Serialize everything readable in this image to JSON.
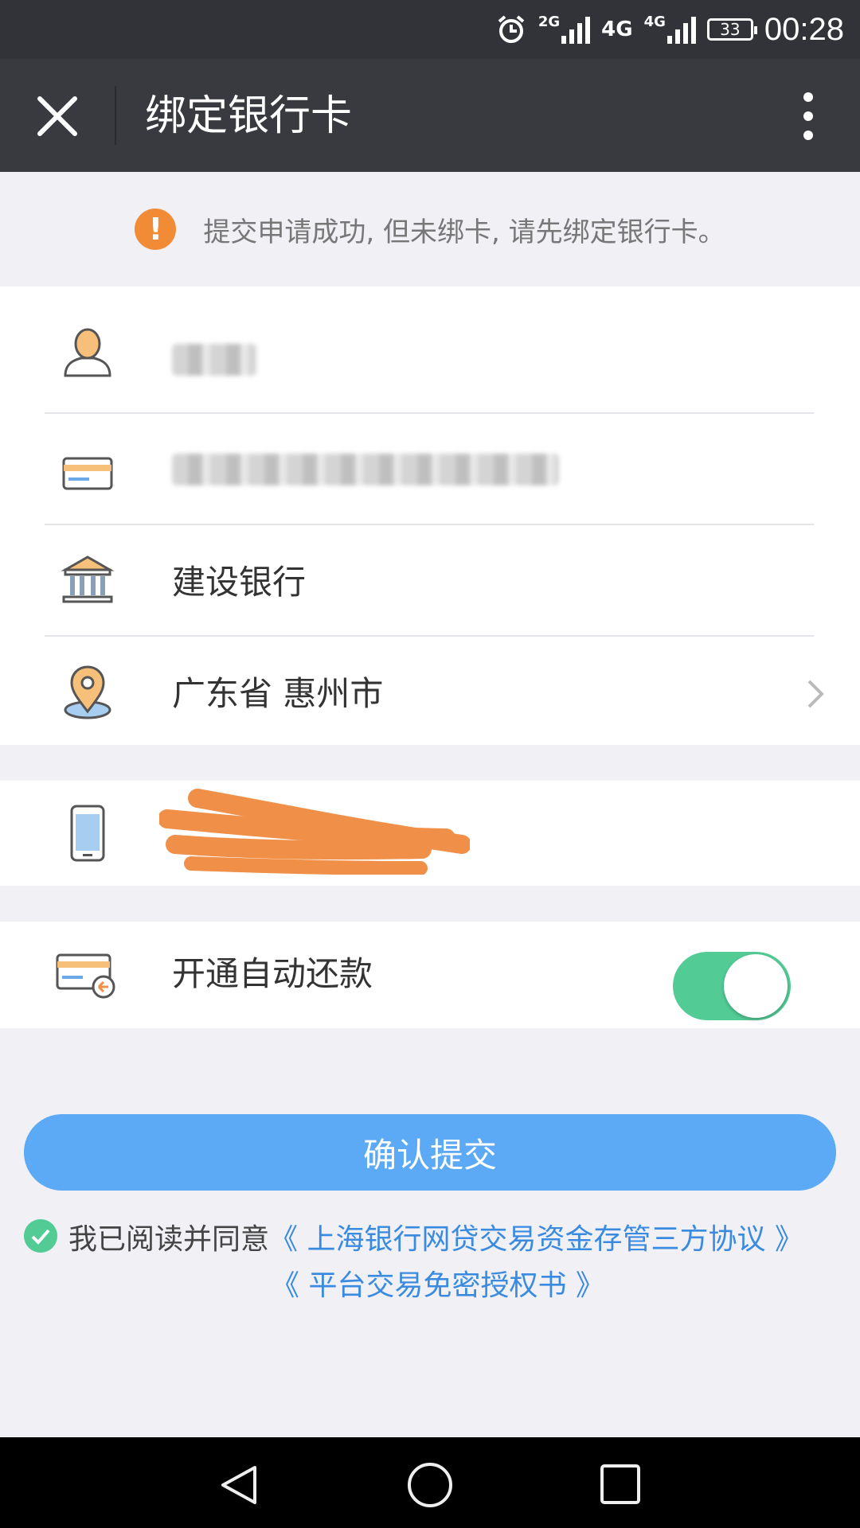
{
  "status_bar": {
    "network_2g": "2G",
    "network_4g_a": "4G",
    "network_4g_b": "4G",
    "battery": "33",
    "time": "00:28"
  },
  "nav": {
    "title": "绑定银行卡",
    "close_icon": "close-icon",
    "more_icon": "more-vertical-icon"
  },
  "notice": {
    "text": "提交申请成功, 但未绑卡, 请先绑定银行卡。",
    "icon": "warning-icon",
    "icon_glyph": "!",
    "icon_color": "#f28b35"
  },
  "form": {
    "bank_name": "建设银行",
    "region": "广东省 惠州市"
  },
  "auto_repay": {
    "label": "开通自动还款",
    "enabled": true,
    "toggle_color": "#52cb95"
  },
  "confirm_button": {
    "label": "确认提交",
    "color": "#5ca9f6"
  },
  "agreement": {
    "checked": true,
    "prefix": "我已阅读并同意",
    "link1": "《 上海银行网贷交易资金存管三方协议 》",
    "link2": "《 平台交易免密授权书 》"
  }
}
